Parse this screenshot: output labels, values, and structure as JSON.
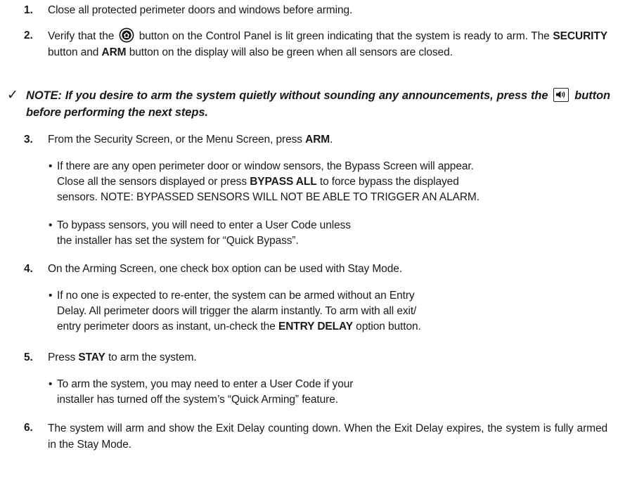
{
  "steps": {
    "s1": {
      "num": "1.",
      "text": "Close all protected perimeter doors and windows before arming."
    },
    "s2": {
      "num": "2.",
      "pre": "Verify that the",
      "post": "button on the Control Panel is lit green indicating that the system is ready to arm. The",
      "bold1": "SECURITY",
      "mid": "button and",
      "bold2": "ARM",
      "end": "button on the display will also be green when all sensors are closed."
    },
    "s3": {
      "num": "3.",
      "text": "From the Security Screen, or the Menu Screen, press",
      "bold": "ARM",
      "end": "."
    },
    "s4": {
      "num": "4.",
      "text": "On the Arming Screen, one check box option can be used with Stay Mode."
    },
    "s5": {
      "num": "5.",
      "pre": "Press",
      "bold": "STAY",
      "post": "to arm the system."
    },
    "s6": {
      "num": "6.",
      "text": "The system will arm and show the Exit Delay counting down. When the Exit Delay expires, the system is fully armed in the Stay Mode."
    }
  },
  "note": {
    "check": "✓",
    "pre": "NOTE: If you desire to arm the system quietly without sounding any announcements, press the",
    "post": "button before performing the next steps."
  },
  "bullets": {
    "b3a": {
      "line1": "If there are any open perimeter door or window sensors, the Bypass Screen will appear.",
      "pre": "Close all the sensors displayed or press",
      "bold": "BYPASS ALL",
      "post": "to force bypass the displayed",
      "line3": "sensors. NOTE: BYPASSED SENSORS WILL NOT BE ABLE TO TRIGGER AN ALARM."
    },
    "b3b": {
      "line1": "To bypass sensors, you will need to enter a User Code unless",
      "line2": "the installer has set the system for “Quick Bypass”."
    },
    "b4a": {
      "line1": "If no one is expected to re-enter, the system can be armed without an Entry",
      "line2": "Delay. All perimeter doors will trigger the alarm instantly. To arm with all exit/",
      "pre": "entry perimeter doors as instant, un-check the",
      "bold": "ENTRY DELAY",
      "post": "option button."
    },
    "b5a": {
      "line1": "To arm the system, you may need to enter a User Code if your",
      "line2": "installer has turned off the system’s “Quick Arming” feature."
    }
  },
  "icons": {
    "home_button": "home-button-icon",
    "speaker_button": "speaker-icon"
  }
}
